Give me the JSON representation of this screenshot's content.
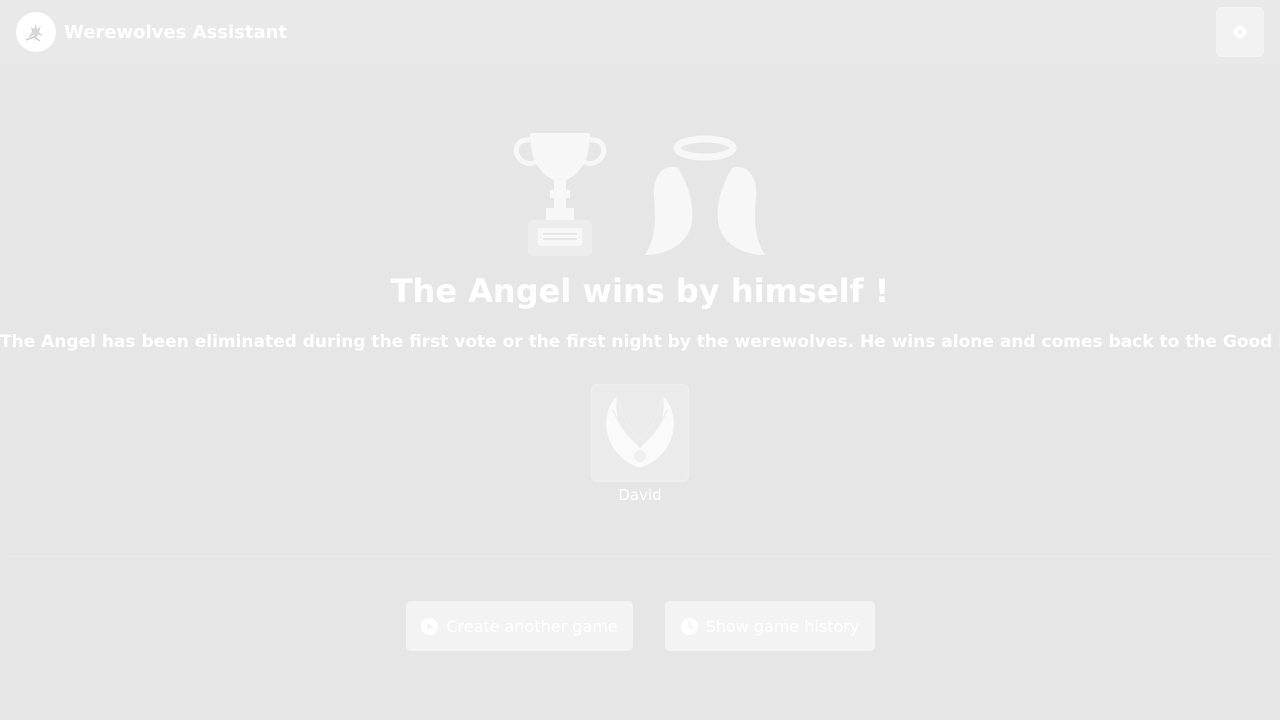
{
  "header": {
    "app_title": "Werewolves Assistant",
    "logo_icon": "werewolf-logo-icon",
    "settings_icon": "gear-icon"
  },
  "result": {
    "trophy_icon": "trophy-icon",
    "side_icon": "angel-wings-icon",
    "title": "The Angel wins by himself !",
    "description": "The Angel has been eliminated during the first vote or the first night by the werewolves. He wins alone and comes back to the Good Place."
  },
  "winners": [
    {
      "name": "David",
      "role_icon": "angel-role-icon"
    }
  ],
  "actions": {
    "create_label": "Create another game",
    "create_icon": "play-circle-icon",
    "history_label": "Show game history",
    "history_icon": "clock-icon"
  },
  "colors": {
    "background": "#e6e6e6",
    "navbar": "#e9e9e9",
    "text": "#ffffff",
    "button": "#f3f3f3"
  }
}
